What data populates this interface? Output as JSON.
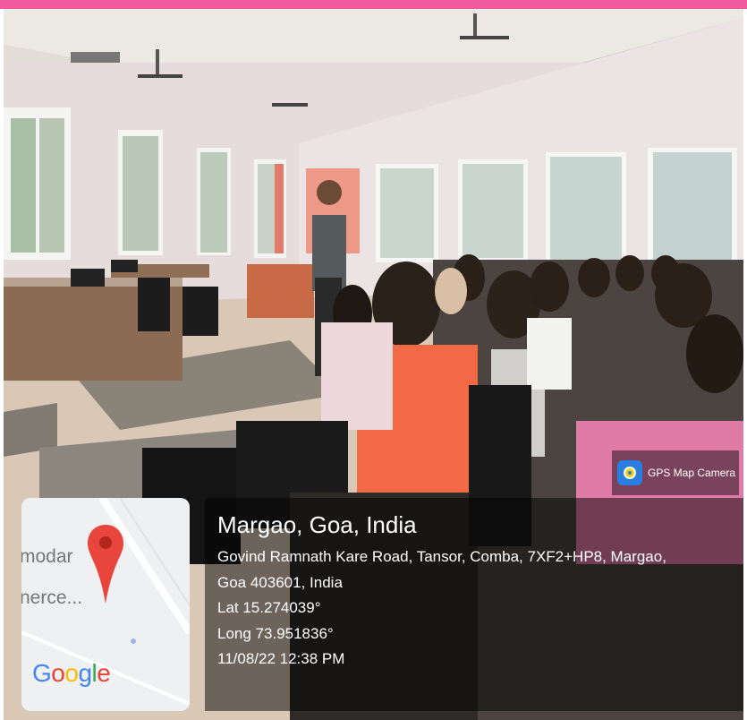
{
  "badge": {
    "label": "GPS Map Camera",
    "icon": "gps-map-camera-icon"
  },
  "map": {
    "label_1": "modar",
    "label_2": "nerce...",
    "google_logo": "Google",
    "pin_color": "#e8453c"
  },
  "location": {
    "title": "Margao, Goa, India",
    "address_line_1": "Govind Ramnath Kare Road, Tansor, Comba, 7XF2+HP8, Margao,",
    "address_line_2": "Goa 403601, India",
    "lat": "Lat 15.274039°",
    "long": "Long 73.951836°",
    "datetime": "11/08/22 12:38 PM"
  },
  "colors": {
    "top_bar": "#f25aa0"
  }
}
